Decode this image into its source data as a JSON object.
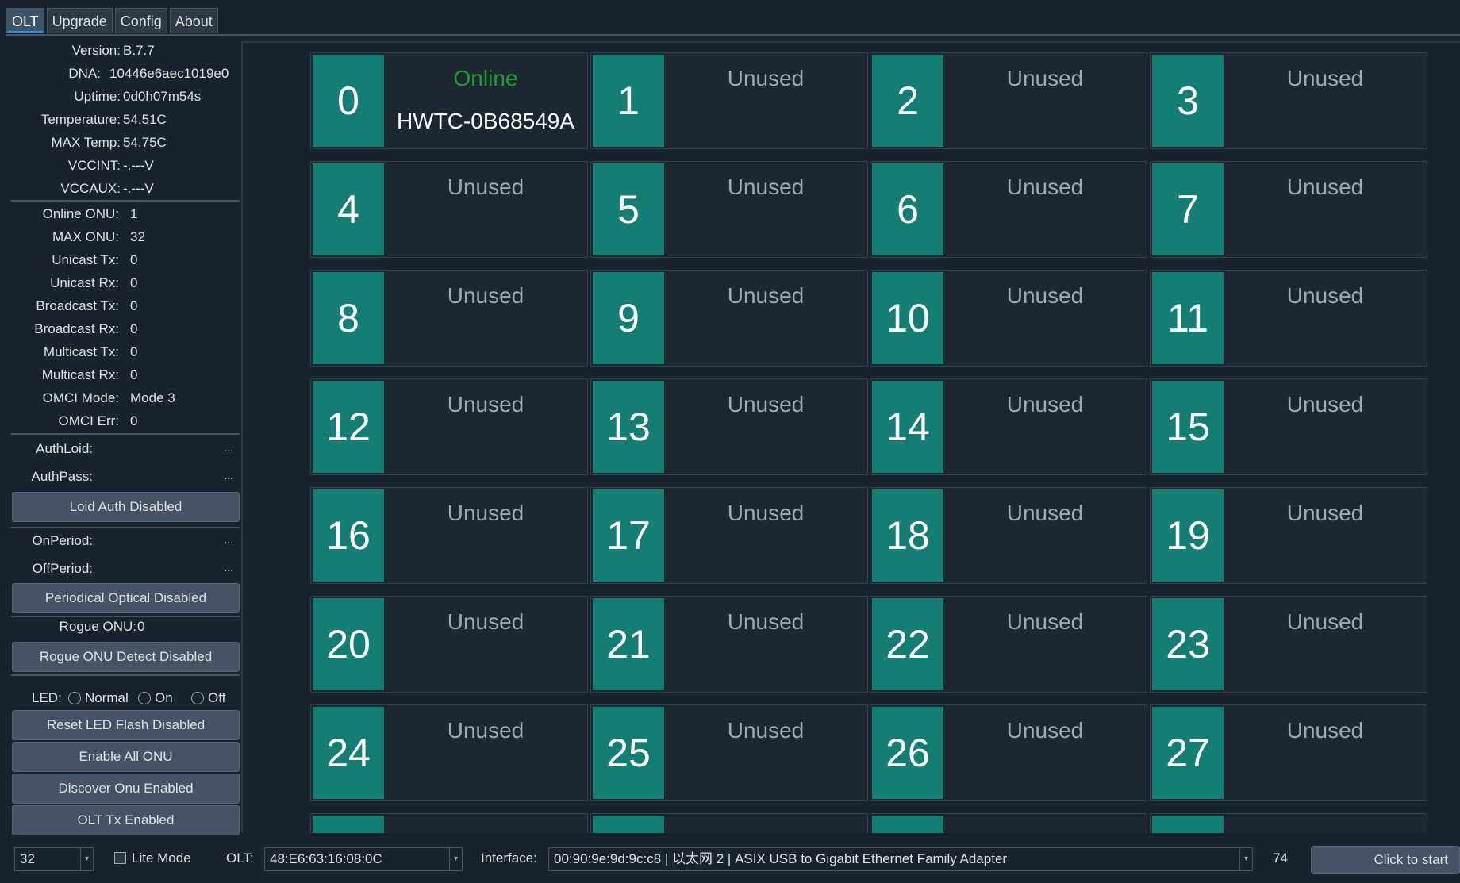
{
  "tabs": [
    "OLT",
    "Upgrade",
    "Config",
    "About"
  ],
  "info": [
    {
      "k": "Version:",
      "v": "B.7.7"
    },
    {
      "k": "DNA:",
      "v": "10446e6aec1019e0"
    },
    {
      "k": "Uptime:",
      "v": "0d0h07m54s"
    },
    {
      "k": "Temperature:",
      "v": "54.51C"
    },
    {
      "k": "MAX Temp:",
      "v": "54.75C"
    },
    {
      "k": "VCCINT:",
      "v": "-.---V"
    },
    {
      "k": "VCCAUX:",
      "v": "-.---V"
    }
  ],
  "stats": [
    {
      "k": "Online ONU:",
      "v": "1"
    },
    {
      "k": "MAX ONU:",
      "v": "32"
    },
    {
      "k": "Unicast Tx:",
      "v": "0"
    },
    {
      "k": "Unicast Rx:",
      "v": "0"
    },
    {
      "k": "Broadcast Tx:",
      "v": "0"
    },
    {
      "k": "Broadcast Rx:",
      "v": "0"
    },
    {
      "k": "Multicast Tx:",
      "v": "0"
    },
    {
      "k": "Multicast Rx:",
      "v": "0"
    },
    {
      "k": "OMCI Mode:",
      "v": "Mode 3"
    },
    {
      "k": "OMCI Err:",
      "v": "0"
    }
  ],
  "auth": {
    "loid_label": "AuthLoid:",
    "loid_value": "...",
    "pass_label": "AuthPass:",
    "pass_value": "...",
    "button": "Loid Auth Disabled"
  },
  "period": {
    "on_label": "OnPeriod:",
    "on_value": "...",
    "off_label": "OffPeriod:",
    "off_value": "...",
    "button": "Periodical Optical Disabled"
  },
  "rogue": {
    "label": "Rogue ONU:",
    "value": "0",
    "button": "Rogue ONU Detect Disabled"
  },
  "led": {
    "label": "LED:",
    "options": [
      "Normal",
      "On",
      "Off"
    ]
  },
  "buttons": [
    "Reset LED Flash Disabled",
    "Enable All ONU",
    "Discover Onu Enabled",
    "OLT Tx Enabled"
  ],
  "onus": [
    {
      "id": "0",
      "status": "Online",
      "serial": "HWTC-0B68549A"
    },
    {
      "id": "1",
      "status": "Unused",
      "serial": ""
    },
    {
      "id": "2",
      "status": "Unused",
      "serial": ""
    },
    {
      "id": "3",
      "status": "Unused",
      "serial": ""
    },
    {
      "id": "4",
      "status": "Unused",
      "serial": ""
    },
    {
      "id": "5",
      "status": "Unused",
      "serial": ""
    },
    {
      "id": "6",
      "status": "Unused",
      "serial": ""
    },
    {
      "id": "7",
      "status": "Unused",
      "serial": ""
    },
    {
      "id": "8",
      "status": "Unused",
      "serial": ""
    },
    {
      "id": "9",
      "status": "Unused",
      "serial": ""
    },
    {
      "id": "10",
      "status": "Unused",
      "serial": ""
    },
    {
      "id": "11",
      "status": "Unused",
      "serial": ""
    },
    {
      "id": "12",
      "status": "Unused",
      "serial": ""
    },
    {
      "id": "13",
      "status": "Unused",
      "serial": ""
    },
    {
      "id": "14",
      "status": "Unused",
      "serial": ""
    },
    {
      "id": "15",
      "status": "Unused",
      "serial": ""
    },
    {
      "id": "16",
      "status": "Unused",
      "serial": ""
    },
    {
      "id": "17",
      "status": "Unused",
      "serial": ""
    },
    {
      "id": "18",
      "status": "Unused",
      "serial": ""
    },
    {
      "id": "19",
      "status": "Unused",
      "serial": ""
    },
    {
      "id": "20",
      "status": "Unused",
      "serial": ""
    },
    {
      "id": "21",
      "status": "Unused",
      "serial": ""
    },
    {
      "id": "22",
      "status": "Unused",
      "serial": ""
    },
    {
      "id": "23",
      "status": "Unused",
      "serial": ""
    },
    {
      "id": "24",
      "status": "Unused",
      "serial": ""
    },
    {
      "id": "25",
      "status": "Unused",
      "serial": ""
    },
    {
      "id": "26",
      "status": "Unused",
      "serial": ""
    },
    {
      "id": "27",
      "status": "Unused",
      "serial": ""
    },
    {
      "id": "",
      "status": "",
      "serial": ""
    },
    {
      "id": "",
      "status": "",
      "serial": ""
    },
    {
      "id": "",
      "status": "",
      "serial": ""
    },
    {
      "id": "",
      "status": "",
      "serial": ""
    }
  ],
  "statusbar": {
    "max_onu_value": "32",
    "lite_mode_label": "Lite Mode",
    "olt_label": "OLT:",
    "olt_value": "48:E6:63:16:08:0C",
    "interface_label": "Interface:",
    "interface_value": "00:90:9e:9d:9c:c8 | 以太网 2 | ASIX USB to Gigabit Ethernet Family Adapter",
    "count": "74",
    "start_button": "Click to start"
  },
  "colors": {
    "accent": "#147e75",
    "online": "#1e9e2e",
    "background": "#19232d"
  }
}
